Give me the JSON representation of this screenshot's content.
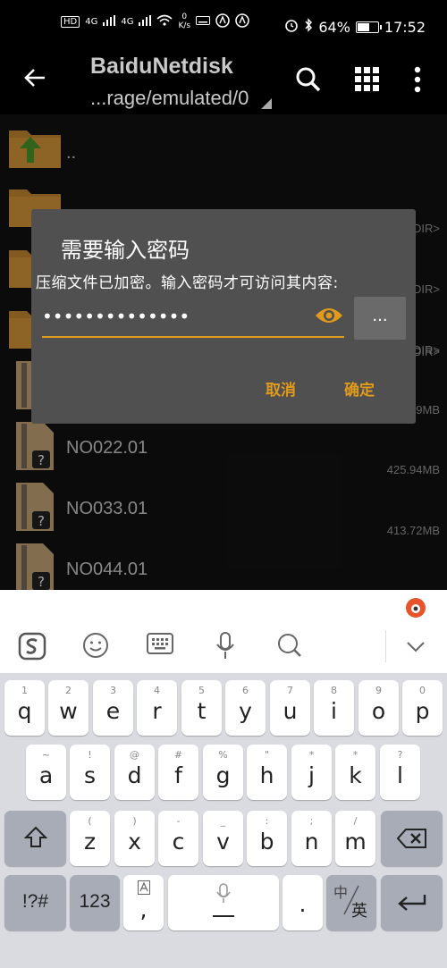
{
  "status_bar": {
    "left_labels": [
      "HD",
      "4G",
      "4G"
    ],
    "speed": "0\nK/s",
    "battery": "64%",
    "battery_level": 0.64,
    "time": "17:52"
  },
  "app_bar": {
    "title": "BaiduNetdisk",
    "path": "...rage/emulated/0"
  },
  "files": [
    {
      "name": "..",
      "size": "",
      "type": "parent"
    },
    {
      "name": "",
      "size": "",
      "type": "folder"
    },
    {
      "name": "",
      "size": "DIR>",
      "type": "folder"
    },
    {
      "name": "",
      "size": "DIR>",
      "type": "folder"
    },
    {
      "name": "",
      "size": "DIR>",
      "type": "folder"
    },
    {
      "name": "",
      "size": "9MB",
      "type": "archive"
    },
    {
      "name": "NO022.01",
      "size": "425.94MB",
      "type": "archive"
    },
    {
      "name": "NO033.01",
      "size": "413.72MB",
      "type": "archive"
    },
    {
      "name": "NO044.01",
      "size": "",
      "type": "archive"
    }
  ],
  "dialog": {
    "title": "需要输入密码",
    "message": "压缩文件已加密。输入密码才可访问其内容:",
    "password_masked": "••••••••••••••",
    "more_label": "...",
    "cancel": "取消",
    "ok": "确定"
  },
  "keyboard": {
    "row1": [
      [
        "q",
        "1"
      ],
      [
        "w",
        "2"
      ],
      [
        "e",
        "3"
      ],
      [
        "r",
        "4"
      ],
      [
        "t",
        "5"
      ],
      [
        "y",
        "6"
      ],
      [
        "u",
        "7"
      ],
      [
        "i",
        "8"
      ],
      [
        "o",
        "9"
      ],
      [
        "p",
        "0"
      ]
    ],
    "row2": [
      [
        "a",
        "~"
      ],
      [
        "s",
        "!"
      ],
      [
        "d",
        "@"
      ],
      [
        "f",
        "#"
      ],
      [
        "g",
        "%"
      ],
      [
        "h",
        "\""
      ],
      [
        "j",
        "*"
      ],
      [
        "k",
        "*"
      ],
      [
        "l",
        "?"
      ]
    ],
    "row3": [
      [
        "z",
        "("
      ],
      [
        "x",
        ")"
      ],
      [
        "c",
        "-"
      ],
      [
        "v",
        "_"
      ],
      [
        "b",
        ":"
      ],
      [
        "n",
        ";"
      ],
      [
        "m",
        "/"
      ]
    ],
    "sym_label": "!?#",
    "num_label": "123",
    "comma": ",",
    "period": ".",
    "lang_top": "中",
    "lang_bottom": "英"
  },
  "colors": {
    "accent": "#e09a1c",
    "dialog_bg": "#505050",
    "folder": "#d99a3b"
  }
}
